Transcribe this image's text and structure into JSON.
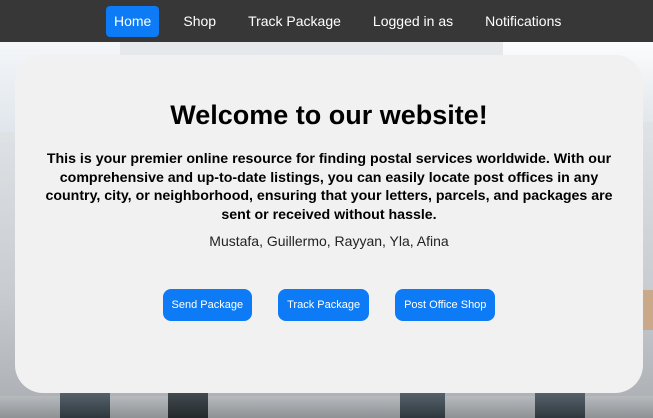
{
  "navbar": {
    "items": [
      {
        "label": "Home",
        "active": true
      },
      {
        "label": "Shop",
        "active": false
      },
      {
        "label": "Track Package",
        "active": false
      },
      {
        "label": "Logged in as",
        "active": false
      },
      {
        "label": "Notifications",
        "active": false
      }
    ]
  },
  "main": {
    "title": "Welcome to our website!",
    "intro": "This is your premier online resource for finding postal services worldwide. With our comprehensive and up-to-date listings, you can easily locate post offices in any country, city, or neighborhood, ensuring that your letters, parcels, and packages are sent or received without hassle.",
    "names": "Mustafa, Guillermo, Rayyan, Yla, Afina",
    "buttons": {
      "send": "Send Package",
      "track": "Track Package",
      "shop": "Post Office Shop"
    }
  },
  "colors": {
    "navbar_bg": "#373737",
    "accent": "#0d7bf5",
    "card_bg": "#f1f1f1"
  }
}
